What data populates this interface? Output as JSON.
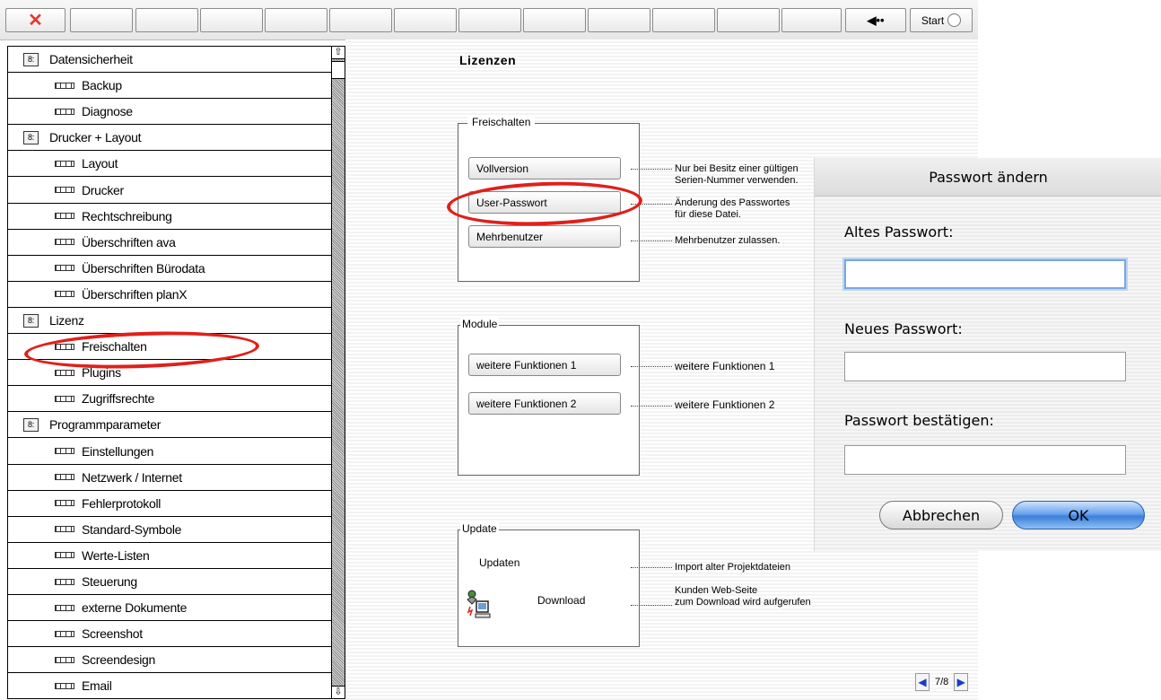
{
  "toolbar": {
    "close_icon": "close-x-icon",
    "back_icon": "back-arrow-icon",
    "start_label": "Start"
  },
  "sidebar": {
    "items": [
      {
        "label": "Datensicherheit",
        "type": "section"
      },
      {
        "label": "Backup",
        "type": "item"
      },
      {
        "label": "Diagnose",
        "type": "item"
      },
      {
        "label": "Drucker + Layout",
        "type": "section"
      },
      {
        "label": "Layout",
        "type": "item"
      },
      {
        "label": "Drucker",
        "type": "item"
      },
      {
        "label": "Rechtschreibung",
        "type": "item"
      },
      {
        "label": "Überschriften ava",
        "type": "item"
      },
      {
        "label": "Überschriften Bürodata",
        "type": "item"
      },
      {
        "label": "Überschriften planX",
        "type": "item"
      },
      {
        "label": "Lizenz",
        "type": "section"
      },
      {
        "label": "Freischalten",
        "type": "item"
      },
      {
        "label": "Plugins",
        "type": "item"
      },
      {
        "label": "Zugriffsrechte",
        "type": "item"
      },
      {
        "label": "Programmparameter",
        "type": "section"
      },
      {
        "label": "Einstellungen",
        "type": "item"
      },
      {
        "label": "Netzwerk / Internet",
        "type": "item"
      },
      {
        "label": "Fehlerprotokoll",
        "type": "item"
      },
      {
        "label": "Standard-Symbole",
        "type": "item"
      },
      {
        "label": "Werte-Listen",
        "type": "item"
      },
      {
        "label": "Steuerung",
        "type": "item"
      },
      {
        "label": "externe Dokumente",
        "type": "item"
      },
      {
        "label": "Screenshot",
        "type": "item"
      },
      {
        "label": "Screendesign",
        "type": "item"
      },
      {
        "label": "Email",
        "type": "item"
      }
    ]
  },
  "main": {
    "title": "Lizenzen",
    "freischalten": {
      "label": "Freischalten",
      "vollversion": {
        "button": "Vollversion",
        "note1": "Nur bei Besitz einer gültigen",
        "note2": "Serien-Nummer verwenden."
      },
      "user_passwort": {
        "button": "User-Passwort",
        "note1": "Änderung des Passwortes",
        "note2": "für diese Datei."
      },
      "mehrbenutzer": {
        "button": "Mehrbenutzer",
        "note1": "Mehrbenutzer zulassen."
      }
    },
    "module": {
      "label": "Module",
      "f1": {
        "button": "weitere Funktionen 1",
        "note": "weitere Funktionen 1"
      },
      "f2": {
        "button": "weitere Funktionen 2",
        "note": "weitere Funktionen 2"
      }
    },
    "update": {
      "label": "Update",
      "updaten": {
        "label": "Updaten",
        "note": "Import alter Projektdateien"
      },
      "download": {
        "label": "Download",
        "note1": "Kunden Web-Seite",
        "note2": "zum Download wird aufgerufen"
      }
    },
    "pager": {
      "text": "7/8"
    }
  },
  "dialog": {
    "title": "Passwort ändern",
    "old_label": "Altes Passwort:",
    "old_value": "",
    "new_label": "Neues Passwort:",
    "new_value": "",
    "confirm_label": "Passwort bestätigen:",
    "confirm_value": "",
    "cancel": "Abbrechen",
    "ok": "OK"
  },
  "colors": {
    "annotation_red": "#e0201b",
    "ok_button_blue": "#3b7fd9"
  }
}
